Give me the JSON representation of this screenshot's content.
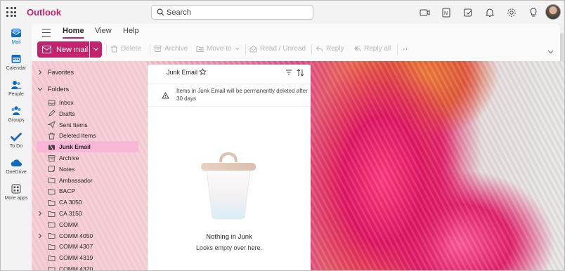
{
  "app": {
    "brand": "Outlook"
  },
  "search": {
    "placeholder": "Search"
  },
  "topbar_icons": [
    "meet-now-icon",
    "onenote-icon",
    "my-day-icon",
    "bell-icon",
    "settings-gear-icon",
    "lightbulb-icon"
  ],
  "rail": {
    "items": [
      {
        "label": "Mail",
        "icon": "mail-icon"
      },
      {
        "label": "Calendar",
        "icon": "calendar-icon"
      },
      {
        "label": "People",
        "icon": "people-icon"
      },
      {
        "label": "Groups",
        "icon": "groups-icon"
      },
      {
        "label": "To Do",
        "icon": "todo-check-icon"
      },
      {
        "label": "OneDrive",
        "icon": "onedrive-cloud-icon"
      },
      {
        "label": "More apps",
        "icon": "more-apps-icon"
      }
    ]
  },
  "ribbon": {
    "tabs": [
      {
        "label": "Home"
      },
      {
        "label": "View"
      },
      {
        "label": "Help"
      }
    ],
    "new_mail": "New mail",
    "commands": {
      "delete": "Delete",
      "archive": "Archive",
      "move_to": "Move to",
      "read_unread": "Read / Unread",
      "reply": "Reply",
      "reply_all": "Reply all"
    },
    "more": "··"
  },
  "nav": {
    "favorites": "Favorites",
    "folders": "Folders",
    "items": [
      {
        "label": "Inbox",
        "icon": "inbox-icon"
      },
      {
        "label": "Drafts",
        "icon": "drafts-pencil-icon"
      },
      {
        "label": "Sent Items",
        "icon": "sent-icon"
      },
      {
        "label": "Deleted Items",
        "icon": "trash-icon"
      },
      {
        "label": "Junk Email",
        "icon": "junk-icon",
        "selected": true
      },
      {
        "label": "Archive",
        "icon": "archive-icon"
      },
      {
        "label": "Notes",
        "icon": "notes-icon"
      },
      {
        "label": "Ambassador",
        "icon": "folder-icon"
      },
      {
        "label": "BACP",
        "icon": "folder-icon"
      },
      {
        "label": "CA 3050",
        "icon": "folder-icon"
      },
      {
        "label": "CA 3150",
        "icon": "folder-icon",
        "expandable": true
      },
      {
        "label": "COMM",
        "icon": "folder-icon"
      },
      {
        "label": "COMM 4050",
        "icon": "folder-icon",
        "expandable": true
      },
      {
        "label": "COMM 4307",
        "icon": "folder-icon"
      },
      {
        "label": "COMM 4319",
        "icon": "folder-icon"
      },
      {
        "label": "COMM 4320",
        "icon": "folder-icon"
      }
    ]
  },
  "list": {
    "title": "Junk Email",
    "notice": "Items in Junk Email will be permanently deleted after 30 days",
    "empty_title": "Nothing in Junk",
    "empty_sub": "Looks empty over here."
  },
  "colors": {
    "accent": "#c5226e",
    "selected_folder": "#f8b7d6"
  }
}
